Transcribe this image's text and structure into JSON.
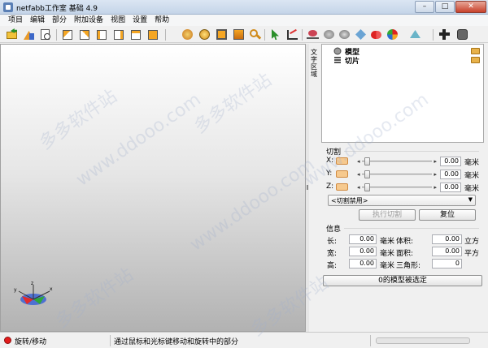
{
  "window": {
    "title": "netfabb工作室 基础 4.9",
    "minimize_glyph": "–",
    "maximize_glyph": "□",
    "close_glyph": "✕"
  },
  "menu": [
    "项目",
    "编辑",
    "部分",
    "附加设备",
    "视图",
    "设置",
    "帮助"
  ],
  "toolbar": {
    "icons": [
      "open-icon",
      "add-part-icon",
      "project-info-icon",
      "view-front-icon",
      "view-back-icon",
      "view-left-icon",
      "view-right-icon",
      "view-top-icon",
      "view-bottom-icon",
      "repair-icon",
      "analysis-icon",
      "scale-icon",
      "transform-icon",
      "zoom-icon",
      "select-icon",
      "measure-icon",
      "cut-icon",
      "mesh-icon",
      "align-icon",
      "support-icon",
      "boolean-icon",
      "section-icon",
      "export-icon",
      "add-icon",
      "settings-icon"
    ]
  },
  "side_tab": {
    "label": "文字区域"
  },
  "tree": {
    "items": [
      {
        "label": "模型",
        "icon": "models-icon"
      },
      {
        "label": "切片",
        "icon": "slices-icon"
      }
    ]
  },
  "cutting": {
    "title": "切割",
    "rows": [
      {
        "axis": "X:",
        "value": "0.00",
        "unit": "毫米"
      },
      {
        "axis": "Y:",
        "value": "0.00",
        "unit": "毫米"
      },
      {
        "axis": "Z:",
        "value": "0.00",
        "unit": "毫米"
      }
    ],
    "mode_selected": "<切割禁用>",
    "execute_label": "执行切割",
    "reset_label": "复位"
  },
  "info": {
    "title": "信息",
    "length_label": "长:",
    "length_value": "0.00",
    "length_unit": "毫米",
    "width_label": "宽:",
    "width_value": "0.00",
    "width_unit": "毫米",
    "height_label": "高:",
    "height_value": "0.00",
    "height_unit": "毫米",
    "volume_label": "体积:",
    "volume_value": "0.00",
    "volume_unit": "立方",
    "area_label": "面积:",
    "area_value": "0.00",
    "area_unit": "平方",
    "triangles_label": "三角形:",
    "triangles_value": "0",
    "selection_status": "0的模型被选定"
  },
  "status": {
    "mode": "旋转/移动",
    "hint": "通过鼠标和光标键移动和旋转中的部分"
  },
  "watermark": {
    "text_cn": "多多软件站",
    "text_url": "www.ddooo.com"
  },
  "colors": {
    "accent": "#e8b24a",
    "status_dot": "#e31b1b"
  }
}
